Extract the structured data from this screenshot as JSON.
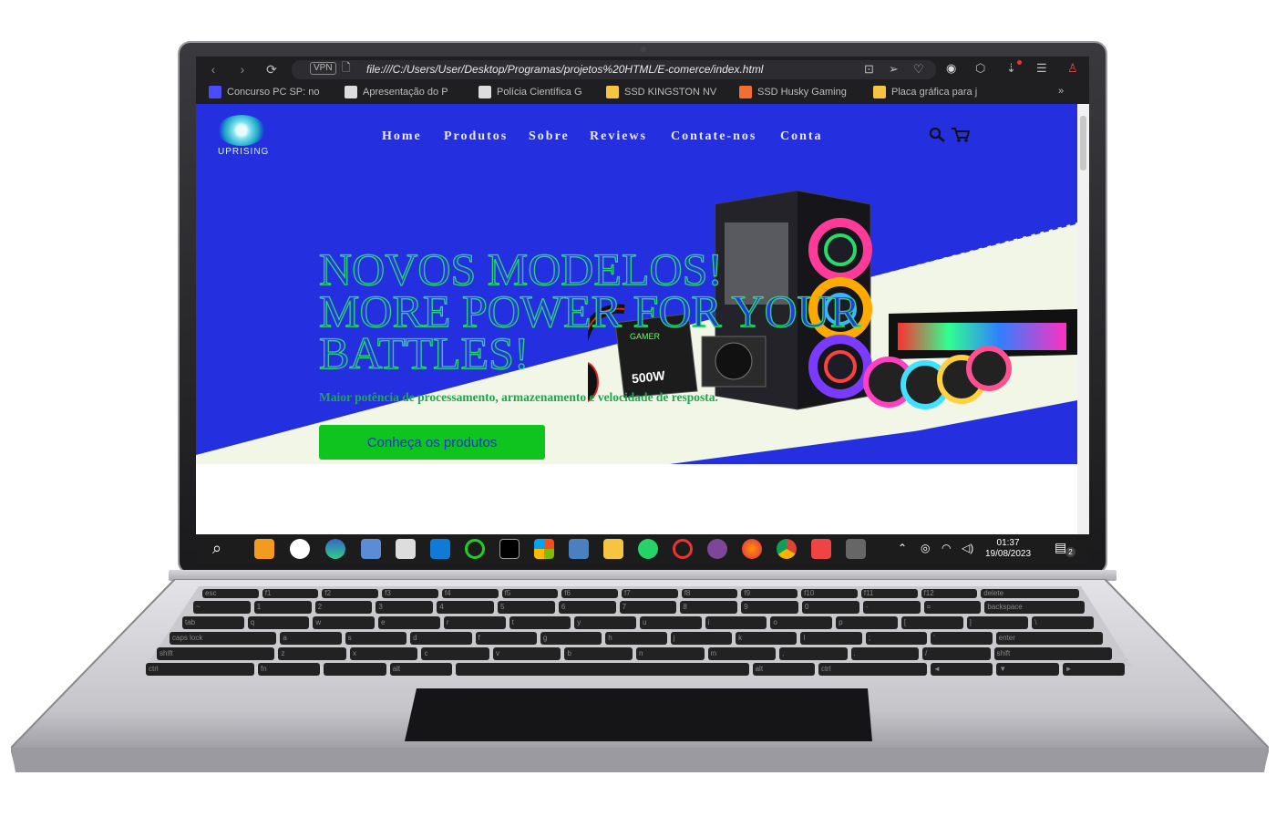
{
  "browser": {
    "url": "file:///C:/Users/User/Desktop/Programas/projetos%20HTML/E-comerce/index.html",
    "vpn_badge": "VPN",
    "bookmarks": [
      {
        "label": "Concurso PC SP: no",
        "color": "#4b4bff"
      },
      {
        "label": "Apresentação do P",
        "color": "#dddddd"
      },
      {
        "label": "Polícia Científica G",
        "color": "#dddddd"
      },
      {
        "label": "SSD KINGSTON NV",
        "color": "#f5c542"
      },
      {
        "label": "SSD Husky Gaming",
        "color": "#f07030"
      },
      {
        "label": "Placa gráfica para j",
        "color": "#f5c542"
      }
    ],
    "more": "»"
  },
  "site": {
    "logo_text": "UPRISING",
    "nav": [
      "Home",
      "Produtos",
      "Sobre",
      "Reviews",
      "Contate-nos",
      "Conta"
    ],
    "hero": {
      "line1": "NOVOS MODELOS!",
      "line2": "MORE POWER FOR YOUR",
      "line3": "BATTLES!",
      "subtitle": "Maior potência de processamento, armazenamento e velocidade de resposta.",
      "cta": "Conheça os produtos"
    },
    "product_labels": {
      "box_brand": "GAMER",
      "box_watt": "500W"
    }
  },
  "taskbar": {
    "time": "01:37",
    "date": "19/08/2023",
    "notifications": "2",
    "apps": [
      "search-icon",
      "sublime-icon",
      "unreal-icon",
      "edge-icon",
      "virtualbox-icon",
      "paint-icon",
      "vscode-icon",
      "refresh-app-icon",
      "terminal-icon",
      "microsoft-icon",
      "calculator-icon",
      "explorer-icon",
      "whatsapp-icon",
      "opera-icon",
      "tor-icon",
      "firefox-icon",
      "chrome-icon",
      "snip-icon",
      "desktop-icon"
    ]
  },
  "keyboard": {
    "row1": [
      "esc",
      "f1",
      "f2",
      "f3",
      "f4",
      "f5",
      "f6",
      "f7",
      "f8",
      "f9",
      "f10",
      "f11",
      "f12",
      "delete"
    ],
    "row2": [
      "~",
      "1",
      "2",
      "3",
      "4",
      "5",
      "6",
      "7",
      "8",
      "9",
      "0",
      "-",
      "=",
      "backspace"
    ],
    "row3": [
      "tab",
      "q",
      "w",
      "e",
      "r",
      "t",
      "y",
      "u",
      "i",
      "o",
      "p",
      "[",
      "]",
      "\\"
    ],
    "row4": [
      "caps lock",
      "a",
      "s",
      "d",
      "f",
      "g",
      "h",
      "j",
      "k",
      "l",
      ";",
      "'",
      "enter"
    ],
    "row5": [
      "shift",
      "z",
      "x",
      "c",
      "v",
      "b",
      "n",
      "m",
      ",",
      ".",
      "/",
      "shift"
    ],
    "row6": [
      "ctrl",
      "fn",
      "",
      "alt",
      "",
      "alt",
      "ctrl",
      "◄",
      "▼",
      "►"
    ]
  },
  "colors": {
    "hero_blue": "#2430e0",
    "cta_green": "#0fc41f",
    "hero_stroke": "#2ad96a"
  }
}
